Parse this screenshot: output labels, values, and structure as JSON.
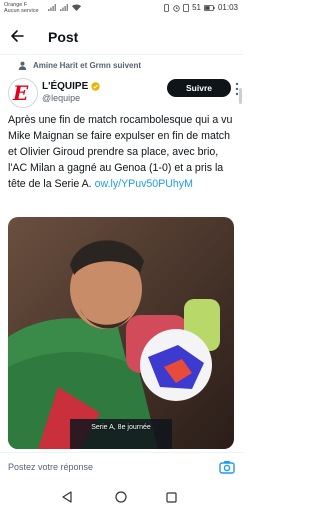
{
  "status_bar": {
    "carrier_line1": "Orange F",
    "carrier_line2": "Aucun service",
    "battery": "51",
    "time": "01:03"
  },
  "header": {
    "title": "Post"
  },
  "social_context": "Amine Harit et Grmn suivent",
  "author": {
    "name": "L'ÉQUIPE",
    "handle": "@lequipe",
    "avatar_letter": "E",
    "brand_color": "#e2001a",
    "verified_color": "#e8b400"
  },
  "follow_button": "Suivre",
  "tweet": {
    "text": "Après une fin de match rocambolesque qui a vu Mike Maignan se faire expulser en fin de match et Olivier Giroud prendre sa place, avec brio, l'AC Milan a gagné au Genoa (1-0) et a pris la tête de la Serie A.",
    "link": "ow.ly/YPuv50PUhyM"
  },
  "media": {
    "caption": "Serie A, 8e journée",
    "description_icon": "photo-of-player-catching-ball"
  },
  "compose": {
    "placeholder": "Postez votre réponse"
  },
  "colors": {
    "link": "#1d9bf0",
    "text": "#0f1419",
    "muted": "#536471"
  }
}
